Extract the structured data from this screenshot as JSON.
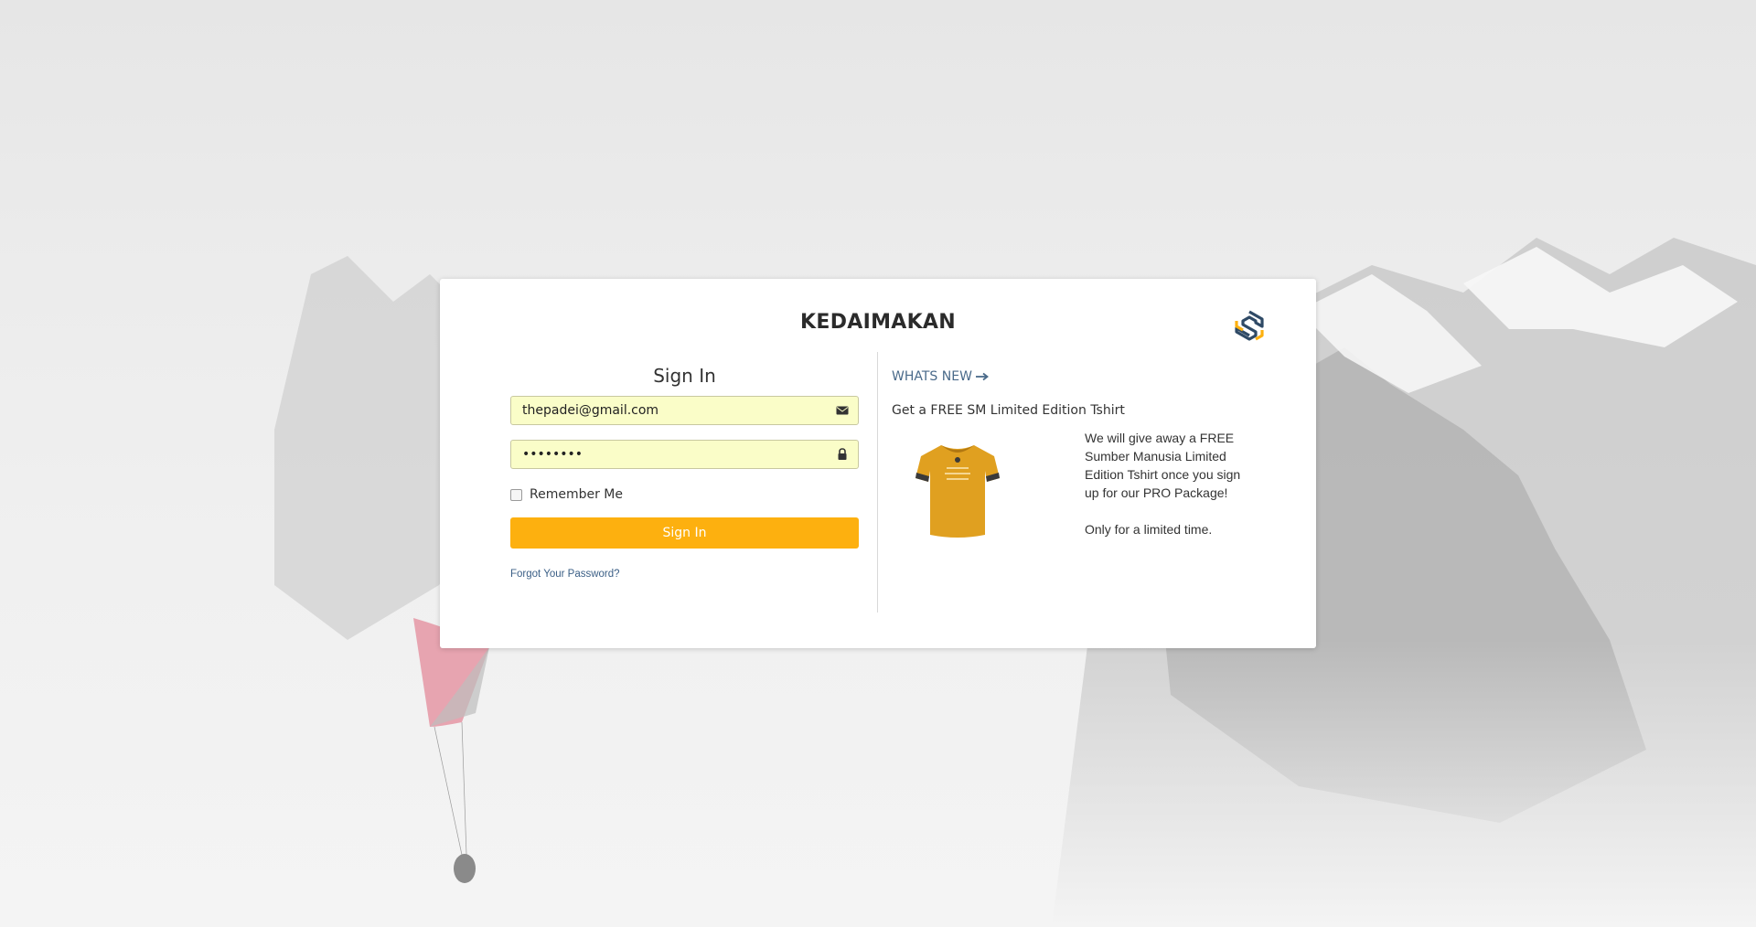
{
  "brand": {
    "title": "KEDAIMAKAN",
    "logo_icon": "hexagon-s-logo-icon"
  },
  "signin": {
    "heading": "Sign In",
    "email_value": "thepadei@gmail.com",
    "email_icon": "envelope-icon",
    "password_value": "thepadei",
    "password_icon": "lock-icon",
    "remember_label": "Remember Me",
    "remember_checked": false,
    "button_label": "Sign In",
    "forgot_label": "Forgot Your Password?"
  },
  "whats_new": {
    "label": "WHATS NEW",
    "arrow_icon": "arrow-right-icon",
    "promo_title": "Get a FREE SM Limited Edition Tshirt",
    "promo_body": "We will give away a FREE Sumber Manusia Limited Edition Tshirt once you sign up for our PRO Package!",
    "promo_note": "Only for a limited time.",
    "image": "orange-tshirt-image"
  },
  "colors": {
    "accent": "#fdb00f",
    "link": "#3b5f86",
    "autofill": "#fafdc8"
  }
}
